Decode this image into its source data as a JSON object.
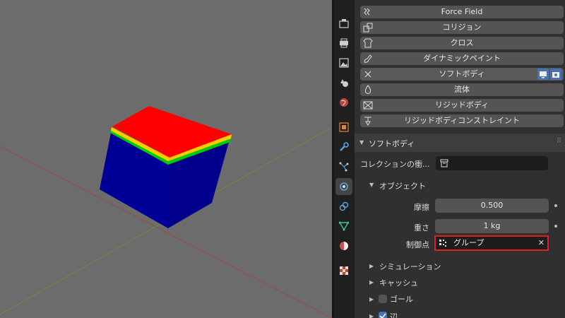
{
  "physics_buttons": [
    {
      "label": "Force Field",
      "icon": "force-field-icon"
    },
    {
      "label": "コリジョン",
      "icon": "collision-icon"
    },
    {
      "label": "クロス",
      "icon": "cloth-icon"
    },
    {
      "label": "ダイナミックペイント",
      "icon": "dynamic-paint-icon"
    },
    {
      "label": "ソフトボディ",
      "icon": "close-icon",
      "active": true
    },
    {
      "label": "流体",
      "icon": "fluid-icon"
    },
    {
      "label": "リジッドボディ",
      "icon": "rigid-body-icon"
    },
    {
      "label": "リジッドボディコンストレイント",
      "icon": "rigid-body-constraint-icon"
    }
  ],
  "softbody": {
    "title": "ソフトボディ",
    "collection_label": "コレクションの衝...",
    "object_title": "オブジェクト",
    "friction_label": "摩擦",
    "friction_value": "0.500",
    "mass_label": "重さ",
    "mass_value": "1 kg",
    "control_point_label": "制御点",
    "control_point_value": "グループ",
    "simulation_label": "シミュレーション",
    "cache_label": "キャッシュ",
    "goal_label": "ゴール",
    "edges_label": "辺"
  },
  "colors": {
    "accent": "#4772b3",
    "highlight": "#e02020",
    "cube_top": "#ff0000",
    "cube_side": "#000099"
  }
}
